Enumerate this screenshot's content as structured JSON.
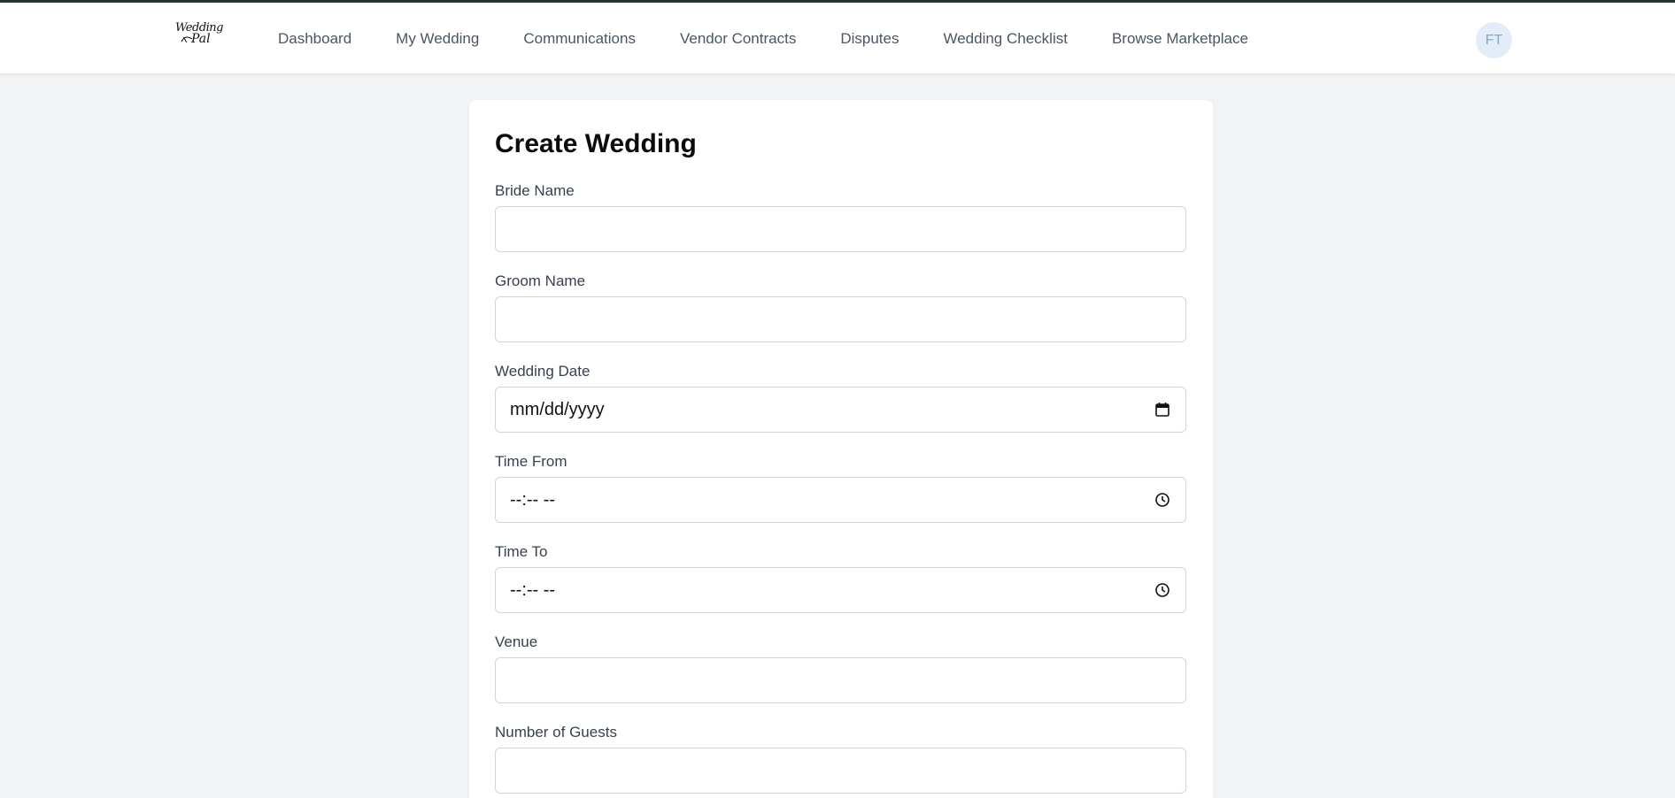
{
  "header": {
    "logo": {
      "line1": "Wedding",
      "line2": "Pal"
    },
    "nav": [
      {
        "label": "Dashboard"
      },
      {
        "label": "My Wedding"
      },
      {
        "label": "Communications"
      },
      {
        "label": "Vendor Contracts"
      },
      {
        "label": "Disputes"
      },
      {
        "label": "Wedding Checklist"
      },
      {
        "label": "Browse Marketplace"
      }
    ],
    "avatar_initials": "FT"
  },
  "form": {
    "title": "Create Wedding",
    "fields": [
      {
        "label": "Bride Name",
        "value": ""
      },
      {
        "label": "Groom Name",
        "value": ""
      },
      {
        "label": "Wedding Date",
        "value": "mm/dd/yyyy",
        "icon": "calendar-icon"
      },
      {
        "label": "Time From",
        "value": "--:-- --",
        "icon": "clock-icon"
      },
      {
        "label": "Time To",
        "value": "--:-- --",
        "icon": "clock-icon"
      },
      {
        "label": "Venue",
        "value": ""
      },
      {
        "label": "Number of Guests",
        "value": ""
      }
    ]
  },
  "colors": {
    "background": "#f2f3f5",
    "topbar_border": "#243531",
    "avatar_bg": "#e3edf9",
    "avatar_text": "#8aa6c8"
  }
}
